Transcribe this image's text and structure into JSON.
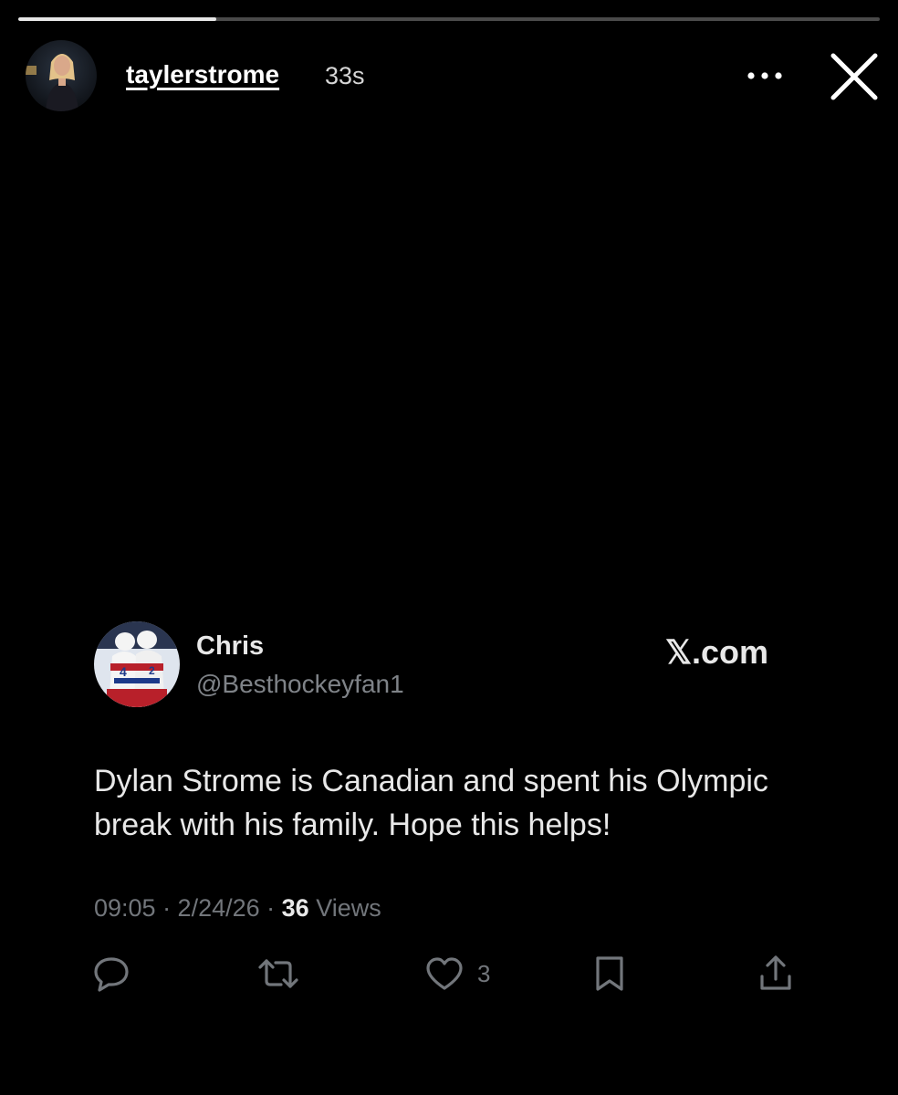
{
  "story": {
    "progress": 0.23,
    "username": "taylerstrome",
    "time_ago": "33s"
  },
  "tweet": {
    "display_name": "Chris",
    "handle": "@Besthockeyfan1",
    "brand": "𝕏.com",
    "text": "Dylan Strome is Canadian and spent his Olympic break with his family. Hope this helps!",
    "meta_time": "09:05 · 2/24/26 · ",
    "views_count": "36",
    "views_label": " Views",
    "like_count": "3"
  },
  "icons": {
    "more": "more-horizontal-icon",
    "close": "close-icon",
    "reply": "reply-icon",
    "repost": "repost-icon",
    "like": "heart-icon",
    "bookmark": "bookmark-icon",
    "share": "share-icon"
  },
  "colors": {
    "background": "#000000",
    "text_primary": "#e8e8e8",
    "text_secondary": "#72767b"
  }
}
